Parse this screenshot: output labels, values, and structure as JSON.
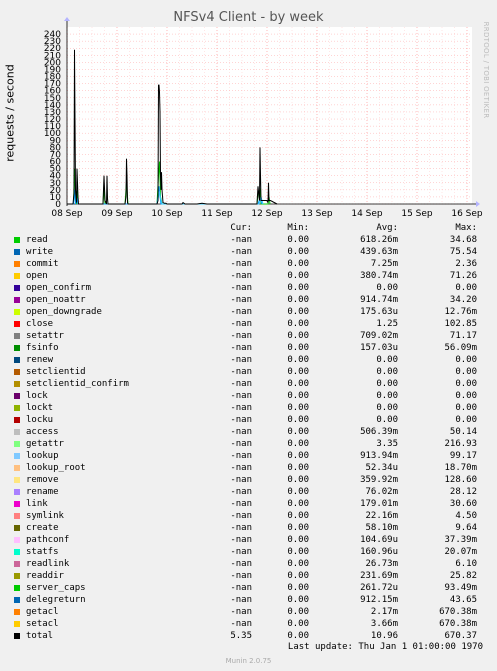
{
  "chart_data": {
    "type": "line",
    "title": "NFSv4 Client - by week",
    "ylabel": "requests / second",
    "side_label": "RRDTOOL / TOBI OETIKER",
    "ylim": [
      0,
      250
    ],
    "yticks": [
      0,
      10,
      20,
      30,
      40,
      50,
      60,
      70,
      80,
      90,
      100,
      110,
      120,
      130,
      140,
      150,
      160,
      170,
      180,
      190,
      200,
      210,
      220,
      230,
      240
    ],
    "xlim": [
      0,
      8.1
    ],
    "xticks": [
      {
        "x": 0,
        "label": "08 Sep"
      },
      {
        "x": 1,
        "label": "09 Sep"
      },
      {
        "x": 2,
        "label": "10 Sep"
      },
      {
        "x": 3,
        "label": "11 Sep"
      },
      {
        "x": 4,
        "label": "12 Sep"
      },
      {
        "x": 5,
        "label": "13 Sep"
      },
      {
        "x": 6,
        "label": "14 Sep"
      },
      {
        "x": 7,
        "label": "15 Sep"
      },
      {
        "x": 8,
        "label": "16 Sep"
      }
    ],
    "series": [
      {
        "name": "total",
        "color": "#000000",
        "x": [
          0,
          0.12,
          0.14,
          0.15,
          0.17,
          0.19,
          0.2,
          0.22,
          0.23,
          0.25,
          0.27,
          0.3,
          0.72,
          0.74,
          0.76,
          0.79,
          0.8,
          0.81,
          0.82,
          0.83,
          1.16,
          1.18,
          1.19,
          1.2,
          1.21,
          1.22,
          1.8,
          1.82,
          1.83,
          1.84,
          1.85,
          1.86,
          1.87,
          1.88,
          1.89,
          1.9,
          1.92,
          1.95,
          1.98,
          2.0,
          2.3,
          2.32,
          2.34,
          2.36,
          2.6,
          2.7,
          2.8,
          3.8,
          3.82,
          3.84,
          3.85,
          3.86,
          3.87,
          3.88,
          3.9,
          3.95,
          4.0,
          4.02,
          4.03,
          4.04,
          4.05,
          4.07,
          4.2
        ],
        "y": [
          0,
          0,
          15,
          218,
          20,
          2,
          50,
          10,
          0,
          0,
          0,
          0,
          0,
          40,
          5,
          0,
          40,
          8,
          0,
          0,
          0,
          10,
          64,
          40,
          2,
          0,
          0,
          5,
          168,
          168,
          158,
          130,
          40,
          20,
          45,
          20,
          2,
          1,
          1,
          0,
          0,
          2,
          1,
          0,
          0,
          1,
          0,
          0,
          25,
          10,
          5,
          80,
          40,
          5,
          5,
          5,
          5,
          2,
          30,
          5,
          5,
          5,
          0
        ]
      },
      {
        "name": "getattr",
        "color": "#00cc00",
        "x": [
          0,
          0.13,
          0.15,
          0.17,
          0.19,
          0.2,
          0.22,
          0.72,
          0.74,
          0.76,
          1.16,
          1.19,
          1.22,
          1.8,
          1.83,
          1.85,
          1.87,
          1.9,
          3.8,
          3.82,
          3.86,
          3.88,
          4.02,
          4.04,
          4.06
        ],
        "y": [
          0,
          0,
          50,
          5,
          0,
          20,
          0,
          0,
          25,
          0,
          0,
          30,
          0,
          0,
          40,
          60,
          10,
          0,
          0,
          15,
          20,
          0,
          0,
          10,
          0
        ]
      },
      {
        "name": "lookup",
        "color": "#0099ff",
        "x": [
          0,
          0.13,
          0.15,
          0.17,
          0.2,
          0.22,
          1.8,
          1.84,
          1.86,
          1.88,
          3.82,
          3.86,
          3.9
        ],
        "y": [
          0,
          0,
          20,
          0,
          8,
          0,
          0,
          25,
          10,
          0,
          0,
          8,
          0
        ]
      },
      {
        "name": "access",
        "color": "#33ccff",
        "x": [
          1.8,
          1.85,
          1.87,
          1.9,
          3.84,
          3.88,
          3.92
        ],
        "y": [
          0,
          18,
          8,
          0,
          0,
          10,
          0
        ]
      }
    ]
  },
  "legend": {
    "headers": {
      "cur": "Cur:",
      "min": "Min:",
      "avg": "Avg:",
      "max": "Max:"
    },
    "rows": [
      {
        "name": "read",
        "color": "#00cc00",
        "cur": "-nan",
        "min": "0.00",
        "avg": "618.26m",
        "max": "34.68"
      },
      {
        "name": "write",
        "color": "#0066b3",
        "cur": "-nan",
        "min": "0.00",
        "avg": "439.63m",
        "max": "75.54"
      },
      {
        "name": "commit",
        "color": "#ff8000",
        "cur": "-nan",
        "min": "0.00",
        "avg": "7.25m",
        "max": "2.36"
      },
      {
        "name": "open",
        "color": "#ffcc00",
        "cur": "-nan",
        "min": "0.00",
        "avg": "380.74m",
        "max": "71.26"
      },
      {
        "name": "open_confirm",
        "color": "#330099",
        "cur": "-nan",
        "min": "0.00",
        "avg": "0.00",
        "max": "0.00"
      },
      {
        "name": "open_noattr",
        "color": "#990099",
        "cur": "-nan",
        "min": "0.00",
        "avg": "914.74m",
        "max": "34.20"
      },
      {
        "name": "open_downgrade",
        "color": "#ccff00",
        "cur": "-nan",
        "min": "0.00",
        "avg": "175.63u",
        "max": "12.76m"
      },
      {
        "name": "close",
        "color": "#ff0000",
        "cur": "-nan",
        "min": "0.00",
        "avg": "1.25",
        "max": "102.85"
      },
      {
        "name": "setattr",
        "color": "#808080",
        "cur": "-nan",
        "min": "0.00",
        "avg": "709.02m",
        "max": "71.17"
      },
      {
        "name": "fsinfo",
        "color": "#008f00",
        "cur": "-nan",
        "min": "0.00",
        "avg": "157.03u",
        "max": "56.09m"
      },
      {
        "name": "renew",
        "color": "#00487d",
        "cur": "-nan",
        "min": "0.00",
        "avg": "0.00",
        "max": "0.00"
      },
      {
        "name": "setclientid",
        "color": "#b35a00",
        "cur": "-nan",
        "min": "0.00",
        "avg": "0.00",
        "max": "0.00"
      },
      {
        "name": "setclientid_confirm",
        "color": "#b38f00",
        "cur": "-nan",
        "min": "0.00",
        "avg": "0.00",
        "max": "0.00"
      },
      {
        "name": "lock",
        "color": "#6b006b",
        "cur": "-nan",
        "min": "0.00",
        "avg": "0.00",
        "max": "0.00"
      },
      {
        "name": "lockt",
        "color": "#8fb300",
        "cur": "-nan",
        "min": "0.00",
        "avg": "0.00",
        "max": "0.00"
      },
      {
        "name": "locku",
        "color": "#b30000",
        "cur": "-nan",
        "min": "0.00",
        "avg": "0.00",
        "max": "0.00"
      },
      {
        "name": "access",
        "color": "#bebebe",
        "cur": "-nan",
        "min": "0.00",
        "avg": "506.39m",
        "max": "50.14"
      },
      {
        "name": "getattr",
        "color": "#80ff80",
        "cur": "-nan",
        "min": "0.00",
        "avg": "3.35",
        "max": "216.93"
      },
      {
        "name": "lookup",
        "color": "#80c9ff",
        "cur": "-nan",
        "min": "0.00",
        "avg": "913.94m",
        "max": "99.17"
      },
      {
        "name": "lookup_root",
        "color": "#ffc080",
        "cur": "-nan",
        "min": "0.00",
        "avg": "52.34u",
        "max": "18.70m"
      },
      {
        "name": "remove",
        "color": "#ffe680",
        "cur": "-nan",
        "min": "0.00",
        "avg": "359.92m",
        "max": "128.60"
      },
      {
        "name": "rename",
        "color": "#aa80ff",
        "cur": "-nan",
        "min": "0.00",
        "avg": "76.02m",
        "max": "28.12"
      },
      {
        "name": "link",
        "color": "#ee00cc",
        "cur": "-nan",
        "min": "0.00",
        "avg": "179.01m",
        "max": "30.60"
      },
      {
        "name": "symlink",
        "color": "#ff8080",
        "cur": "-nan",
        "min": "0.00",
        "avg": "22.16m",
        "max": "4.50"
      },
      {
        "name": "create",
        "color": "#666600",
        "cur": "-nan",
        "min": "0.00",
        "avg": "58.10m",
        "max": "9.64"
      },
      {
        "name": "pathconf",
        "color": "#ffbfff",
        "cur": "-nan",
        "min": "0.00",
        "avg": "104.69u",
        "max": "37.39m"
      },
      {
        "name": "statfs",
        "color": "#00ffcc",
        "cur": "-nan",
        "min": "0.00",
        "avg": "160.96u",
        "max": "20.07m"
      },
      {
        "name": "readlink",
        "color": "#cc6699",
        "cur": "-nan",
        "min": "0.00",
        "avg": "26.73m",
        "max": "6.10"
      },
      {
        "name": "readdir",
        "color": "#999900",
        "cur": "-nan",
        "min": "0.00",
        "avg": "231.69m",
        "max": "25.82"
      },
      {
        "name": "server_caps",
        "color": "#00cc00",
        "cur": "-nan",
        "min": "0.00",
        "avg": "261.72u",
        "max": "93.49m"
      },
      {
        "name": "delegreturn",
        "color": "#0066b3",
        "cur": "-nan",
        "min": "0.00",
        "avg": "912.15m",
        "max": "43.65"
      },
      {
        "name": "getacl",
        "color": "#ff8000",
        "cur": "-nan",
        "min": "0.00",
        "avg": "2.17m",
        "max": "670.38m"
      },
      {
        "name": "setacl",
        "color": "#ffcc00",
        "cur": "-nan",
        "min": "0.00",
        "avg": "3.66m",
        "max": "670.38m"
      },
      {
        "name": "total",
        "color": "#000000",
        "cur": "5.35",
        "min": "0.00",
        "avg": "10.96",
        "max": "670.37"
      }
    ]
  },
  "last_update": "Last update: Thu Jan  1 01:00:00 1970",
  "munin_version": "Munin 2.0.75"
}
